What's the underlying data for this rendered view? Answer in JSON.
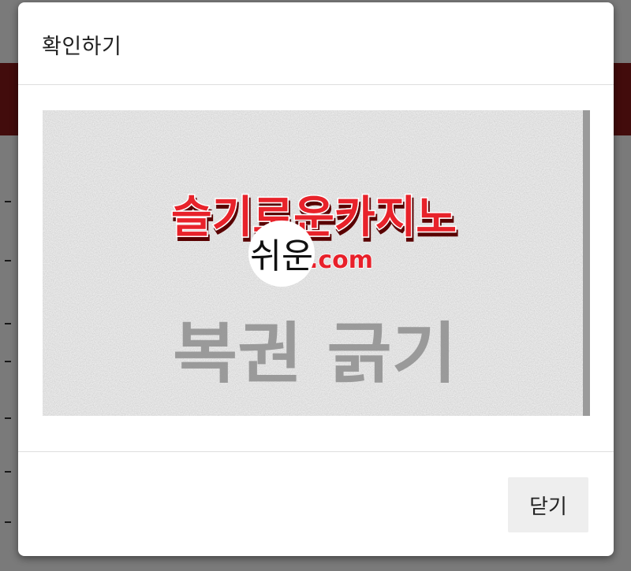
{
  "modal": {
    "title": "확인하기",
    "close_label": "닫기"
  },
  "captcha": {
    "brand_text": "슬기로운카지노",
    "domain_text": ".com",
    "watermark_text": "복권 긁기",
    "scratch_text": "쉬운"
  },
  "colors": {
    "brand_red": "#e8202a",
    "captcha_bg": "#c7c7c7",
    "watermark": "#8e8e8e",
    "button_bg": "#eeeeee"
  }
}
